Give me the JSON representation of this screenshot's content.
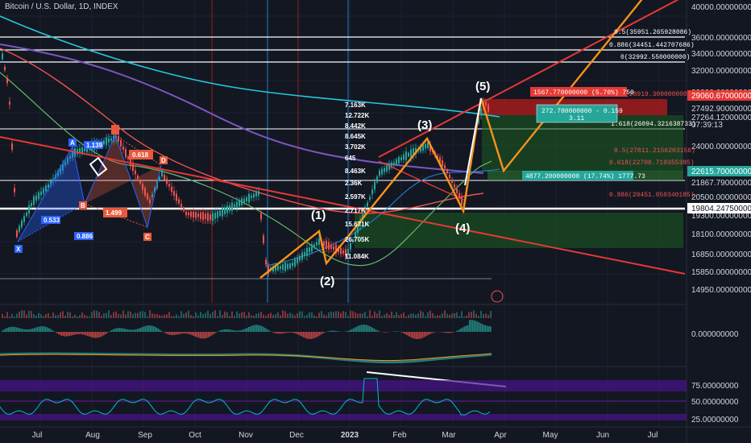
{
  "chart_title": "Bitcoin / U.S. Dollar, 1D, INDEX",
  "colors": {
    "background": "#131722",
    "grid": "#1e2230",
    "up_candle": "#26a69a",
    "down_candle": "#ef5350",
    "wave_line": "#f7931a",
    "trend_red": "#e53935",
    "fib_level": "#ffffff",
    "harmonic_blue": "#2962ff",
    "harmonic_red": "#e85a3c",
    "rsi_line": "#00bcd4",
    "rsi_band": "#6a1b9a"
  },
  "price_axis": {
    "ticks": [
      "40000.000000000",
      "36000.000000000",
      "34000.000000000",
      "32000.000000000",
      "30000.000000000",
      "27492.900000000",
      "27264.120000000",
      "24000.000000000",
      "21867.790000000",
      "20500.000000000",
      "19300.000000000",
      "18100.000000000",
      "16850.000000000",
      "15850.000000000",
      "14950.000000000"
    ],
    "highlighted": [
      {
        "text": "29060.670000000",
        "color": "#e53935"
      },
      {
        "text": "22615.700000000",
        "color": "#26a69a"
      },
      {
        "text": "19804.247500000",
        "color": "#ffffff"
      }
    ],
    "countdown": "07:39:13"
  },
  "macd_axis": {
    "zero": "0.000000000"
  },
  "rsi_axis": {
    "ticks": [
      "75.00000000",
      "50.00000000",
      "25.00000000"
    ]
  },
  "time_axis": {
    "labels": [
      "Jul",
      "Aug",
      "Sep",
      "Oct",
      "Nov",
      "Dec",
      "2023",
      "Feb",
      "Mar",
      "Apr",
      "May",
      "Jun",
      "Jul"
    ]
  },
  "fib_labels": [
    "0.5(35951.265928086)",
    "0.886(34451.442707686)",
    "0(32992.550000000)",
    "(28919.300000000)",
    "1.618(26094.321638733)",
    "0.5(27811.2156203156)",
    "0.618(22700.719355385)",
    "0.886(20451.050340185)"
  ],
  "volume_profile": [
    "7.163K",
    "12.722K",
    "8.442K",
    "8.645K",
    "3.702K",
    "645",
    "8.463K",
    "2.36K",
    "2.597K",
    "2.717K",
    "15.671K",
    "26.705K",
    "11.084K"
  ],
  "position_box": {
    "target": "1567.770000000 (5.70%) 750",
    "risk_reward_line1": "272.780000000 - 0.159",
    "risk_reward_line2": "3.11",
    "stop": "4877.200000000 (17.74%) 1777.73"
  },
  "wave_labels": [
    "(1)",
    "(2)",
    "(3)",
    "(4)",
    "(5)"
  ],
  "harmonic_points": [
    "X",
    "A",
    "B",
    "C",
    "D"
  ],
  "harmonic_ratios": [
    "0.533",
    "0.886",
    "1.139",
    "1.499",
    "0.618"
  ],
  "chart_data": {
    "type": "candlestick",
    "title": "Bitcoin / U.S. Dollar, 1D, INDEX",
    "x_months": [
      "Jul",
      "Aug",
      "Sep",
      "Oct",
      "Nov",
      "Dec",
      "2023",
      "Feb",
      "Mar",
      "Apr",
      "May",
      "Jun",
      "Jul"
    ],
    "ylim": [
      14500,
      40500
    ],
    "price_series": [
      [
        "early Jun",
        30000
      ],
      [
        "mid Jun",
        20500
      ],
      [
        "late Jun",
        19000
      ],
      [
        "Jul",
        19800
      ],
      [
        "Jul",
        21800
      ],
      [
        "Aug",
        23500
      ],
      [
        "mid Aug",
        24200
      ],
      [
        "late Aug",
        20000
      ],
      [
        "Sep",
        21000
      ],
      [
        "mid Sep",
        19400
      ],
      [
        "Oct",
        19300
      ],
      [
        "Oct",
        20000
      ],
      [
        "Nov",
        20800
      ],
      [
        "mid Nov",
        16500
      ],
      [
        "Dec",
        17000
      ],
      [
        "late Dec",
        16600
      ],
      [
        "2023",
        16700
      ],
      [
        "mid Jan",
        21000
      ],
      [
        "Feb",
        23500
      ],
      [
        "mid Feb",
        24300
      ],
      [
        "Mar",
        23500
      ],
      [
        "mid Mar",
        20100
      ],
      [
        "late Mar",
        28000
      ],
      [
        "late Mar",
        27500
      ]
    ],
    "wave_points": [
      {
        "label": "(1)",
        "x": "early Dec",
        "y": 18300
      },
      {
        "label": "(2)",
        "x": "mid Dec",
        "y": 16700
      },
      {
        "label": "(3)",
        "x": "mid Feb",
        "y": 25000
      },
      {
        "label": "(4)",
        "x": "mid Mar",
        "y": 19700
      },
      {
        "label": "(5)",
        "x": "late Mar",
        "y": 28900
      }
    ],
    "rsi_levels": [
      75,
      50,
      25
    ]
  }
}
